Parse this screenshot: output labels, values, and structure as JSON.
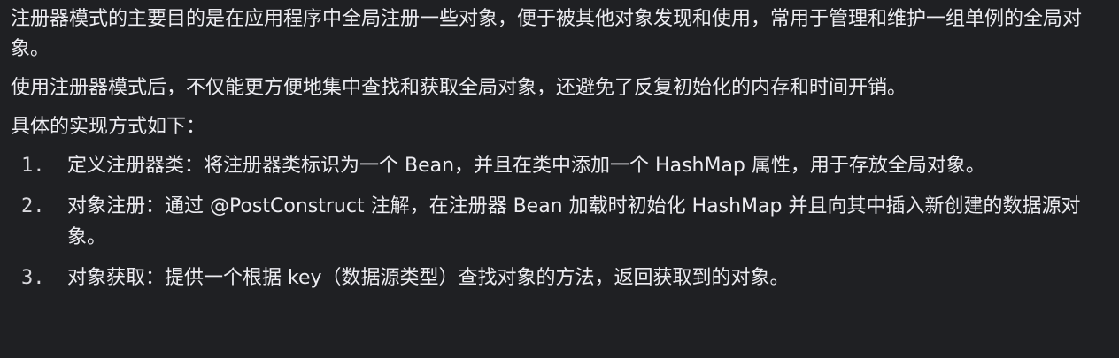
{
  "paragraphs": [
    "注册器模式的主要目的是在应用程序中全局注册一些对象，便于被其他对象发现和使用，常用于管理和维护一组单例的全局对象。",
    "使用注册器模式后，不仅能更方便地集中查找和获取全局对象，还避免了反复初始化的内存和时间开销。",
    "具体的实现方式如下："
  ],
  "list": [
    {
      "number": "1.",
      "text": "定义注册器类：将注册器类标识为一个 Bean，并且在类中添加一个 HashMap 属性，用于存放全局对象。"
    },
    {
      "number": "2.",
      "text": "对象注册：通过 @PostConstruct 注解，在注册器 Bean 加载时初始化 HashMap 并且向其中插入新创建的数据源对象。"
    },
    {
      "number": "3.",
      "text": "对象获取：提供一个根据 key（数据源类型）查找对象的方法，返回获取到的对象。"
    }
  ]
}
